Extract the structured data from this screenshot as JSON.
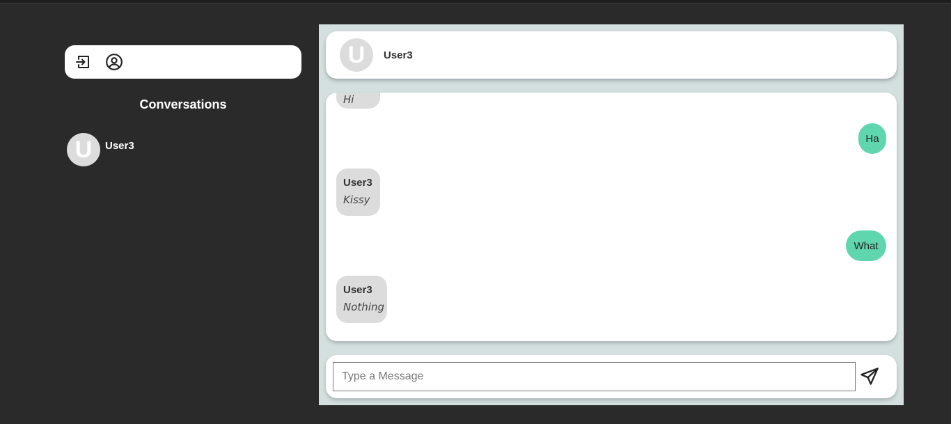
{
  "sidebar": {
    "title": "Conversations",
    "conversations": [
      {
        "initial": "U",
        "name": "User3"
      }
    ],
    "toolbar": {
      "icons": [
        "logout-icon",
        "user-circle-icon"
      ]
    }
  },
  "chat": {
    "header": {
      "initial": "U",
      "name": "User3"
    },
    "messages": [
      {
        "direction": "in",
        "sender": "",
        "text": "Hi"
      },
      {
        "direction": "out",
        "text": "Ha"
      },
      {
        "direction": "in",
        "sender": "User3",
        "text": "Kissy"
      },
      {
        "direction": "out",
        "text": "What"
      },
      {
        "direction": "in",
        "sender": "User3",
        "text": "Nothing"
      }
    ],
    "composer": {
      "placeholder": "Type a Message",
      "value": ""
    }
  },
  "colors": {
    "background": "#2a2a2a",
    "panel": "#d4e0e0",
    "outgoing_bubble": "#5fd6ae",
    "incoming_bubble": "#dcdcdc"
  }
}
